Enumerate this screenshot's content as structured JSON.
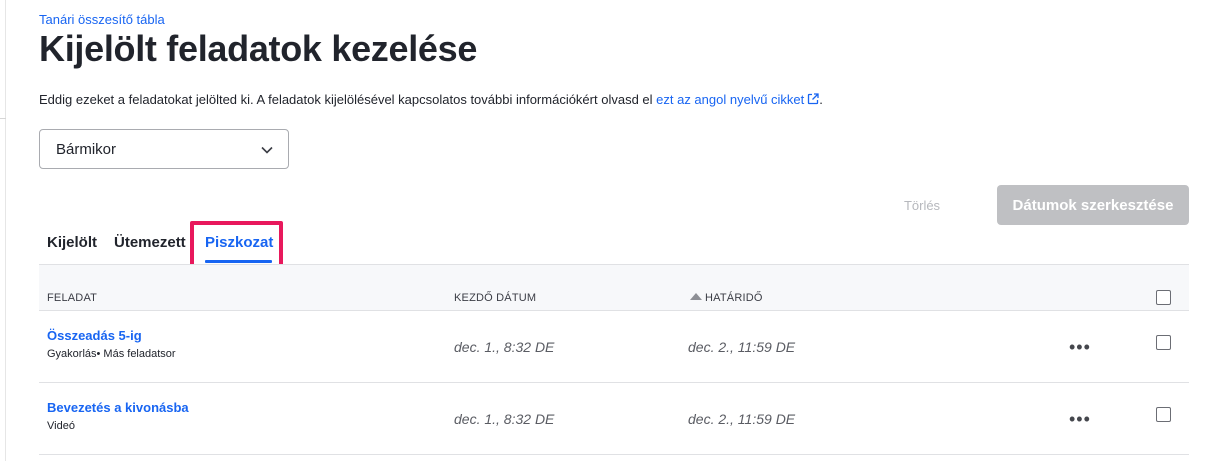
{
  "breadcrumb": "Tanári összesítő tábla",
  "page_title": "Kijelölt feladatok kezelése",
  "description": {
    "text": "Eddig ezeket a feladatokat jelölted ki. A feladatok kijelölésével kapcsolatos további információkért olvasd el ",
    "link_text": "ezt az angol nyelvű cikket",
    "suffix": "."
  },
  "filter": {
    "selected": "Bármikor"
  },
  "actions": {
    "delete_label": "Törlés",
    "edit_dates_label": "Dátumok szerkesztése"
  },
  "tabs": [
    {
      "label": "Kijelölt",
      "active": false
    },
    {
      "label": "Ütemezett",
      "active": false
    },
    {
      "label": "Piszkozat",
      "active": true
    }
  ],
  "table": {
    "columns": [
      "FELADAT",
      "KEZDŐ DÁTUM",
      "HATÁRIDŐ"
    ],
    "rows": [
      {
        "title": "Összeadás 5-ig",
        "subtitle": "Gyakorlás• Más feladatsor",
        "start": "dec. 1., 8:32 DE",
        "due": "dec. 2., 11:59 DE",
        "menu": "•••"
      },
      {
        "title": "Bevezetés a kivonásba",
        "subtitle": "Videó",
        "start": "dec. 1., 8:32 DE",
        "due": "dec. 2., 11:59 DE",
        "menu": "•••"
      }
    ]
  },
  "colors": {
    "accent": "#1865f2",
    "highlight": "#e8185c",
    "disabled_button": "#bfc0c3"
  }
}
